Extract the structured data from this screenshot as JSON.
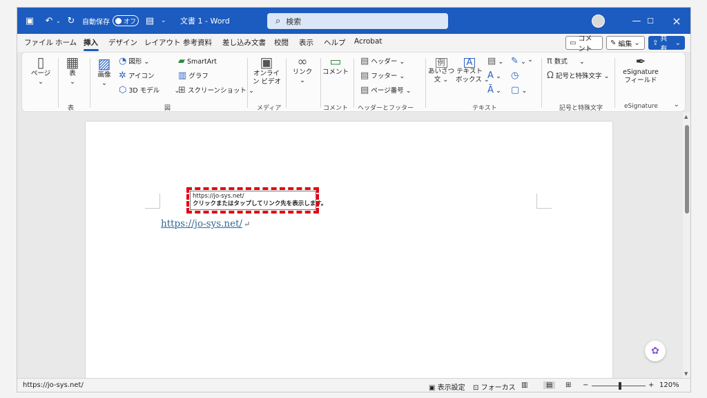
{
  "titlebar": {
    "autosave_label": "自動保存",
    "autosave_state": "オフ",
    "doc_title": "文書 1  -  Word",
    "search_placeholder": "検索"
  },
  "tabs": [
    "ファイル",
    "ホーム",
    "挿入",
    "デザイン",
    "レイアウト",
    "参考資料",
    "差し込み文書",
    "校閲",
    "表示",
    "ヘルプ",
    "Acrobat"
  ],
  "tab_buttons": {
    "comment": "コメント",
    "edit": "編集",
    "share": "共有"
  },
  "ribbon": {
    "page": "ページ",
    "table": "表",
    "image": "画像",
    "shapes": "図形",
    "icons": "アイコン",
    "models3d": "3D モデル",
    "smartart": "SmartArt",
    "chart": "グラフ",
    "screenshot": "スクリーンショット",
    "online_video_1": "オンライ",
    "online_video_2": "ン ビデオ",
    "link": "リンク",
    "comment": "コメント",
    "header": "ヘッダー",
    "footer": "フッター",
    "page_number": "ページ番号",
    "aisatsu_1": "あいさつ",
    "aisatsu_2": "文",
    "textbox_1": "テキスト",
    "textbox_2": "ボックス",
    "equation": "数式",
    "symbol": "記号と特殊文字",
    "esig_1": "eSignature",
    "esig_2": "フィールド",
    "groups": {
      "table": "表",
      "illustrations": "図",
      "media": "メディア",
      "comment": "コメント",
      "header_footer": "ヘッダーとフッター",
      "text": "テキスト",
      "symbols": "記号と特殊文字",
      "esignature": "eSignature"
    }
  },
  "document": {
    "link_text": "https://jo-sys.net/",
    "tooltip_url": "https://jo-sys.net/",
    "tooltip_hint": "クリックまたはタップしてリンク先を表示します。"
  },
  "statusbar": {
    "left_text": "https://jo-sys.net/",
    "display_settings": "表示設定",
    "focus": "フォーカス",
    "zoom": "120%"
  },
  "colors": {
    "titlebar": "#1c5bbf",
    "highlight": "#e60012",
    "link": "#34678f"
  }
}
